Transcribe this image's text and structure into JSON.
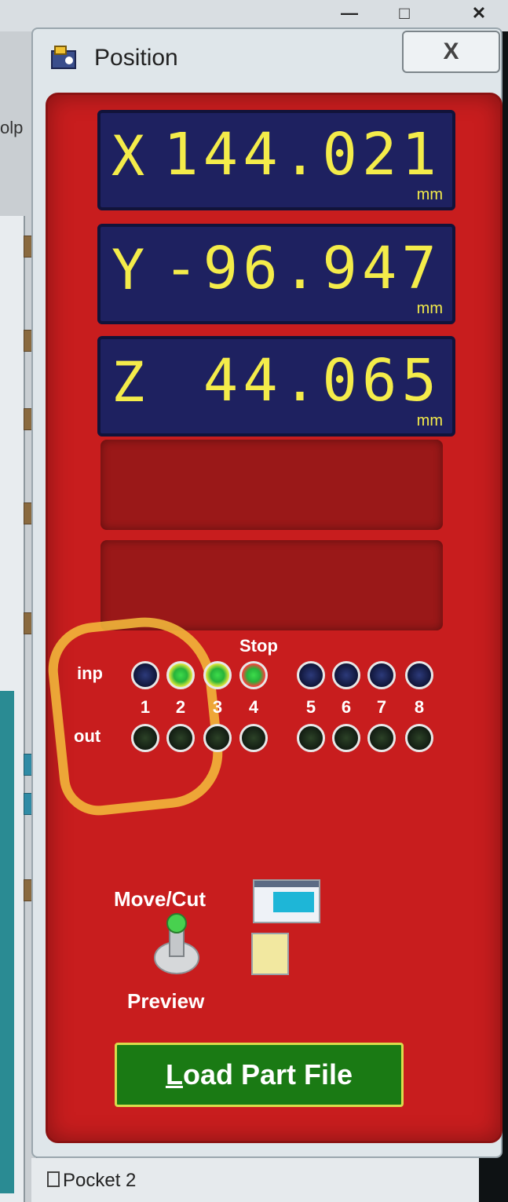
{
  "window": {
    "minimize_icon": "minimize-icon",
    "maximize_icon": "maximize-icon",
    "close_icon": "close-icon"
  },
  "background": {
    "left_partial_text": "olp"
  },
  "dialog": {
    "title": "Position",
    "app_icon": "machine-icon",
    "close_label": "X"
  },
  "dro": {
    "x": {
      "axis": "X",
      "value": "144.021",
      "unit": "mm"
    },
    "y": {
      "axis": "Y",
      "value": "-96.947",
      "unit": "mm"
    },
    "z": {
      "axis": "Z",
      "value": "44.065",
      "unit": "mm"
    }
  },
  "io": {
    "stop_label": "Stop",
    "inp_label": "inp",
    "out_label": "out",
    "numbers": [
      "1",
      "2",
      "3",
      "4",
      "5",
      "6",
      "7",
      "8"
    ],
    "inputs": [
      {
        "state": "off"
      },
      {
        "state": "on"
      },
      {
        "state": "on"
      },
      {
        "state": "on-stop"
      },
      {
        "state": "off"
      },
      {
        "state": "off"
      },
      {
        "state": "off"
      },
      {
        "state": "off"
      }
    ],
    "outputs": [
      {
        "state": "off"
      },
      {
        "state": "off"
      },
      {
        "state": "off"
      },
      {
        "state": "off"
      },
      {
        "state": "off"
      },
      {
        "state": "off"
      },
      {
        "state": "off"
      },
      {
        "state": "off"
      }
    ]
  },
  "mode": {
    "move_cut_label": "Move/Cut",
    "preview_label": "Preview"
  },
  "load_button": {
    "first_letter": "L",
    "rest": "oad Part File"
  },
  "bottom": {
    "pocket_label": "Pocket 2"
  },
  "colors": {
    "panel_red": "#c81d1e",
    "dro_bg": "#1e2160",
    "dro_text": "#f4ec4a",
    "load_button_bg": "#1a7a14"
  }
}
